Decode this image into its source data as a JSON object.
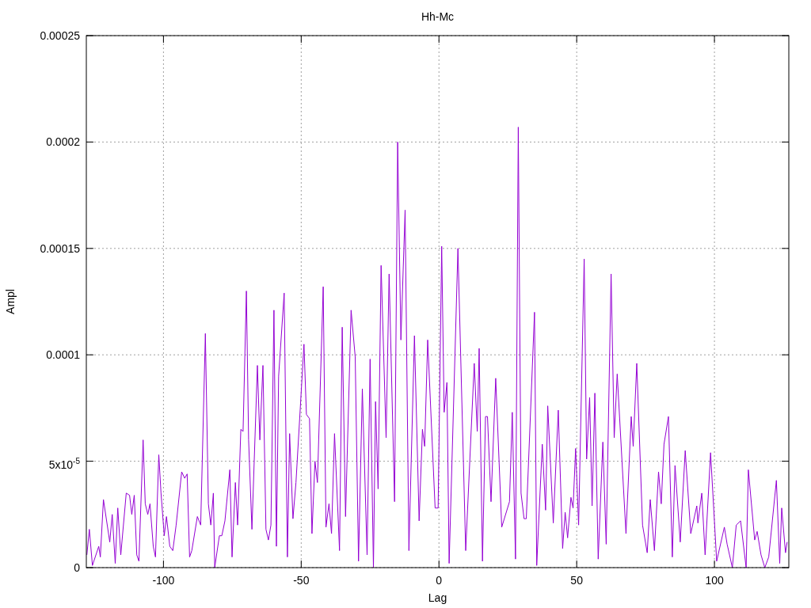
{
  "chart_data": {
    "type": "line",
    "grid": true,
    "title": "Hh-Mc",
    "xlabel": "Lag",
    "ylabel": "Ampl",
    "xlim": [
      -128,
      127
    ],
    "ylim": [
      0,
      0.00025
    ],
    "xticks": [
      -100,
      -50,
      0,
      50,
      100
    ],
    "yticks": [
      {
        "value": 0,
        "label": "0"
      },
      {
        "value": 5e-05,
        "label": "5x10$^{-5}$"
      },
      {
        "value": 0.0001,
        "label": "0.0001"
      },
      {
        "value": 0.00015,
        "label": "0.00015"
      },
      {
        "value": 0.0002,
        "label": "0.0002"
      },
      {
        "value": 0.00025,
        "label": "0.00025"
      }
    ],
    "x": [
      -127.8,
      -126.9,
      -125.8,
      -123.5,
      -122.9,
      -121.8,
      -119.5,
      -118.6,
      -117.5,
      -116.6,
      -115.5,
      -113.5,
      -112.3,
      -111.5,
      -110.6,
      -109.7,
      -108.9,
      -107.4,
      -106.6,
      -105.7,
      -104.9,
      -103.7,
      -102.9,
      -101.7,
      -100.9,
      -99.7,
      -98.9,
      -97.7,
      -96.6,
      -95.4,
      -93.4,
      -92.3,
      -91.4,
      -90.5,
      -89.7,
      -87.7,
      -86.5,
      -84.8,
      -83.7,
      -82.8,
      -81.9,
      -81.4,
      -79.7,
      -78.8,
      -77.7,
      -75.9,
      -75.1,
      -73.9,
      -73.1,
      -71.9,
      -71.1,
      -69.9,
      -69.1,
      -67.9,
      -65.9,
      -65.0,
      -63.9,
      -62.8,
      -61.9,
      -61.0,
      -59.9,
      -59.0,
      -58.2,
      -56.2,
      -55.0,
      -54.2,
      -53.0,
      -51.9,
      -49.0,
      -48.1,
      -47.0,
      -46.1,
      -45.0,
      -44.1,
      -42.0,
      -41.0,
      -39.9,
      -39.0,
      -37.9,
      -36.1,
      -35.1,
      -33.9,
      -31.9,
      -30.4,
      -29.2,
      -27.8,
      -26.1,
      -25.0,
      -23.8,
      -23.0,
      -22.1,
      -21.0,
      -19.2,
      -18.1,
      -16.1,
      -15.0,
      -13.8,
      -12.3,
      -10.9,
      -8.9,
      -7.2,
      -6.0,
      -5.2,
      -4.1,
      -1.4,
      -0.3,
      1.0,
      1.9,
      2.9,
      3.7,
      6.9,
      9.7,
      12.8,
      13.9,
      14.6,
      15.8,
      16.9,
      17.6,
      18.9,
      20.6,
      22.8,
      25.6,
      26.6,
      27.8,
      28.8,
      29.8,
      30.9,
      31.7,
      34.7,
      35.5,
      37.5,
      38.7,
      39.5,
      41.5,
      43.3,
      44.9,
      45.8,
      46.7,
      47.9,
      48.7,
      49.6,
      50.7,
      52.7,
      53.6,
      54.7,
      55.6,
      56.6,
      57.8,
      59.5,
      60.7,
      62.5,
      63.6,
      64.7,
      67.9,
      69.8,
      70.5,
      71.8,
      73.9,
      75.6,
      76.7,
      78.2,
      79.7,
      80.7,
      81.7,
      83.3,
      84.7,
      85.7,
      87.6,
      89.4,
      91.4,
      93.6,
      94.0,
      95.4,
      96.6,
      98.6,
      100.8,
      103.6,
      104.6,
      106.5,
      107.9,
      109.5,
      111.5,
      112.3,
      114.6,
      115.5,
      116.9,
      118.3,
      119.7,
      122.5,
      123.7,
      124.4,
      125.8,
      126.4
    ],
    "series": [
      {
        "color": "#9400d3",
        "values": [
          6e-06,
          1.8e-05,
          1e-06,
          1e-05,
          5e-06,
          3.2e-05,
          1.2e-05,
          2.5e-05,
          2e-06,
          2.8e-05,
          6e-06,
          3.5e-05,
          3.4e-05,
          2.5e-05,
          3.4e-05,
          6e-06,
          3e-06,
          6e-05,
          3e-05,
          2.5e-05,
          3e-05,
          1e-05,
          5e-06,
          5.3e-05,
          3.5e-05,
          1.5e-05,
          2.4e-05,
          1e-05,
          8e-06,
          2e-05,
          4.5e-05,
          4.2e-05,
          4.4e-05,
          5e-06,
          8e-06,
          2.4e-05,
          2e-05,
          0.00011,
          3e-05,
          2e-05,
          3.5e-05,
          0,
          1.5e-05,
          1.5e-05,
          2.2e-05,
          4.6e-05,
          5e-06,
          4e-05,
          2e-05,
          6.5e-05,
          6.4e-05,
          0.00013,
          6e-05,
          1.8e-05,
          9.5e-05,
          6e-05,
          9.5e-05,
          1.8e-05,
          1.3e-05,
          2e-05,
          0.000121,
          1e-05,
          9e-05,
          0.000129,
          5e-06,
          6.3e-05,
          2.3e-05,
          4e-05,
          0.000105,
          7.2e-05,
          7e-05,
          1.6e-05,
          5e-05,
          4e-05,
          0.000132,
          1.9e-05,
          3e-05,
          1.6e-05,
          6.3e-05,
          8e-06,
          0.000113,
          2.4e-05,
          0.000121,
          9.9e-05,
          3e-06,
          8.4e-05,
          6e-06,
          9.8e-05,
          0,
          7.8e-05,
          3.7e-05,
          0.000142,
          6.1e-05,
          0.000138,
          3.1e-05,
          0.0002,
          0.000107,
          0.000168,
          8e-06,
          0.000109,
          2.2e-05,
          6.5e-05,
          5.7e-05,
          0.000107,
          2.8e-05,
          2.8e-05,
          0.000151,
          7.3e-05,
          8.7e-05,
          2e-06,
          0.00015,
          8e-06,
          9.6e-05,
          6.4e-05,
          0.000103,
          3e-06,
          7.1e-05,
          7.1e-05,
          3.1e-05,
          8.9e-05,
          1.9e-05,
          3.1e-05,
          7.3e-05,
          4e-06,
          0.000207,
          3.5e-05,
          2.3e-05,
          2.3e-05,
          0.00012,
          1e-06,
          5.8e-05,
          2.7e-05,
          7.6e-05,
          2.1e-05,
          7.4e-05,
          9e-06,
          2.6e-05,
          1.4e-05,
          3.3e-05,
          2.8e-05,
          5.6e-05,
          2e-05,
          0.000145,
          5.1e-05,
          8e-05,
          2.9e-05,
          8.2e-05,
          4e-06,
          5.9e-05,
          1.1e-05,
          0.000138,
          6.1e-05,
          9.1e-05,
          1.6e-05,
          7.1e-05,
          5.7e-05,
          9.6e-05,
          2e-05,
          7e-06,
          3.2e-05,
          8e-06,
          4.5e-05,
          3e-05,
          5.8e-05,
          7.1e-05,
          5e-06,
          4.8e-05,
          1.2e-05,
          5.5e-05,
          1.6e-05,
          2.9e-05,
          2.1e-05,
          3.5e-05,
          6e-06,
          5.4e-05,
          3e-06,
          1.9e-05,
          1.1e-05,
          0,
          2e-05,
          2.2e-05,
          0,
          4.6e-05,
          1.3e-05,
          1.7e-05,
          6e-06,
          0,
          5e-06,
          4.1e-05,
          2e-06,
          2.8e-05,
          7e-06,
          1.2e-05
        ]
      }
    ]
  }
}
